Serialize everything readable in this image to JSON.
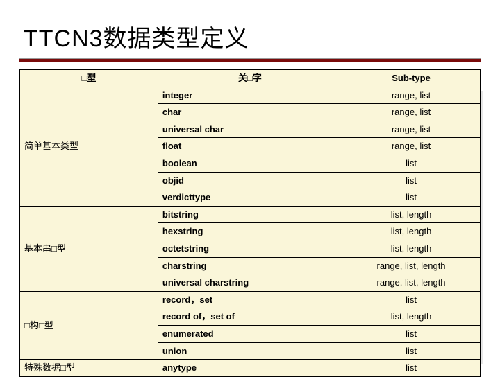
{
  "title": "TTCN3数据类型定义",
  "headers": {
    "col1": "□型",
    "col2": "关□字",
    "col3": "Sub-type"
  },
  "groups": [
    {
      "category": "简单基本类型",
      "rows": [
        {
          "kw": "integer",
          "sub": "range, list"
        },
        {
          "kw": "char",
          "sub": "range, list"
        },
        {
          "kw": "universal char",
          "sub": "range, list"
        },
        {
          "kw": "float",
          "sub": "range, list"
        },
        {
          "kw": "boolean",
          "sub": "list"
        },
        {
          "kw": "objid",
          "sub": "list"
        },
        {
          "kw": "verdicttype",
          "sub": "list"
        }
      ]
    },
    {
      "category": "基本串□型",
      "rows": [
        {
          "kw": "bitstring",
          "sub": "list, length"
        },
        {
          "kw": "hexstring",
          "sub": "list, length"
        },
        {
          "kw": "octetstring",
          "sub": "list, length"
        },
        {
          "kw": "charstring",
          "sub": "range, list, length"
        },
        {
          "kw": "universal charstring",
          "sub": "range, list, length"
        }
      ]
    },
    {
      "category": "□构□型",
      "rows": [
        {
          "kw": "record，set",
          "sub": "list"
        },
        {
          "kw": "record of，set of",
          "sub": "list, length"
        },
        {
          "kw": "enumerated",
          "sub": "list"
        },
        {
          "kw": "union",
          "sub": "list"
        }
      ]
    },
    {
      "category": "特殊数据□型",
      "rows": [
        {
          "kw": "anytype",
          "sub": "list"
        }
      ]
    }
  ],
  "chart_data": {
    "type": "table",
    "title": "TTCN3数据类型定义",
    "columns": [
      "类型",
      "关键字",
      "Sub-type"
    ],
    "rows": [
      [
        "简单基本类型",
        "integer",
        "range, list"
      ],
      [
        "简单基本类型",
        "char",
        "range, list"
      ],
      [
        "简单基本类型",
        "universal char",
        "range, list"
      ],
      [
        "简单基本类型",
        "float",
        "range, list"
      ],
      [
        "简单基本类型",
        "boolean",
        "list"
      ],
      [
        "简单基本类型",
        "objid",
        "list"
      ],
      [
        "简单基本类型",
        "verdicttype",
        "list"
      ],
      [
        "基本串类型",
        "bitstring",
        "list, length"
      ],
      [
        "基本串类型",
        "hexstring",
        "list, length"
      ],
      [
        "基本串类型",
        "octetstring",
        "list, length"
      ],
      [
        "基本串类型",
        "charstring",
        "range, list, length"
      ],
      [
        "基本串类型",
        "universal charstring",
        "range, list, length"
      ],
      [
        "结构类型",
        "record, set",
        "list"
      ],
      [
        "结构类型",
        "record of, set of",
        "list, length"
      ],
      [
        "结构类型",
        "enumerated",
        "list"
      ],
      [
        "结构类型",
        "union",
        "list"
      ],
      [
        "特殊数据类型",
        "anytype",
        "list"
      ]
    ]
  }
}
